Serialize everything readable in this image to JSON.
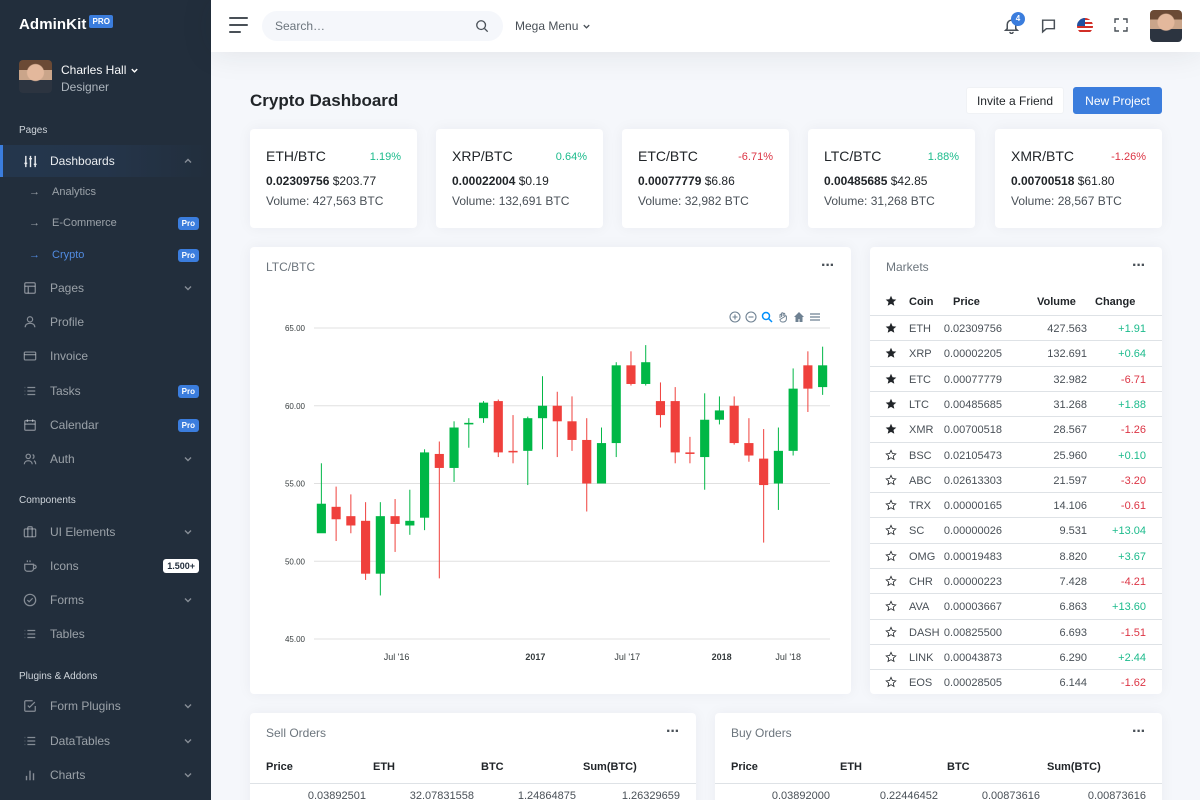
{
  "brand": {
    "name": "AdminKit",
    "badge": "PRO"
  },
  "user": {
    "name": "Charles Hall",
    "role": "Designer"
  },
  "sidebar": {
    "sections": [
      "Pages",
      "Components",
      "Plugins & Addons"
    ],
    "dashboards": "Dashboards",
    "sub": [
      {
        "label": "Analytics",
        "badge": ""
      },
      {
        "label": "E-Commerce",
        "badge": "Pro"
      },
      {
        "label": "Crypto",
        "badge": "Pro"
      }
    ],
    "items": [
      {
        "label": "Pages",
        "icon": "layout-icon"
      },
      {
        "label": "Profile",
        "icon": "user-icon"
      },
      {
        "label": "Invoice",
        "icon": "credit-card-icon"
      },
      {
        "label": "Tasks",
        "icon": "list-icon",
        "badge": "Pro"
      },
      {
        "label": "Calendar",
        "icon": "calendar-icon",
        "badge": "Pro"
      },
      {
        "label": "Auth",
        "icon": "users-icon"
      },
      {
        "label": "UI Elements",
        "icon": "briefcase-icon"
      },
      {
        "label": "Icons",
        "icon": "coffee-icon",
        "badge": "1.500+"
      },
      {
        "label": "Forms",
        "icon": "check-circle-icon"
      },
      {
        "label": "Tables",
        "icon": "list-icon"
      },
      {
        "label": "Form Plugins",
        "icon": "check-square-icon"
      },
      {
        "label": "DataTables",
        "icon": "list-icon"
      },
      {
        "label": "Charts",
        "icon": "bar-chart-icon"
      }
    ]
  },
  "topbar": {
    "search_placeholder": "Search…",
    "mega_menu": "Mega Menu",
    "notifications_count": "4"
  },
  "page": {
    "title_bold": "Crypto",
    "title_rest": " Dashboard",
    "invite_button": "Invite a Friend",
    "new_project_button": "New Project"
  },
  "stats": [
    {
      "pair": "ETH/BTC",
      "change": "1.19%",
      "trend": "pos",
      "btc": "0.02309756",
      "usd": "$203.77",
      "volume": "Volume: 427,563 BTC"
    },
    {
      "pair": "XRP/BTC",
      "change": "0.64%",
      "trend": "pos",
      "btc": "0.00022004",
      "usd": "$0.19",
      "volume": "Volume: 132,691 BTC"
    },
    {
      "pair": "ETC/BTC",
      "change": "-6.71%",
      "trend": "neg",
      "btc": "0.00077779",
      "usd": "$6.86",
      "volume": "Volume: 32,982 BTC"
    },
    {
      "pair": "LTC/BTC",
      "change": "1.88%",
      "trend": "pos",
      "btc": "0.00485685",
      "usd": "$42.85",
      "volume": "Volume: 31,268 BTC"
    },
    {
      "pair": "XMR/BTC",
      "change": "-1.26%",
      "trend": "neg",
      "btc": "0.00700518",
      "usd": "$61.80",
      "volume": "Volume: 28,567 BTC"
    }
  ],
  "chart_card": {
    "title": "LTC/BTC"
  },
  "chart_data": {
    "type": "candlestick",
    "ylim": [
      45,
      65
    ],
    "yticks": [
      "65.00",
      "60.00",
      "55.00",
      "50.00",
      "45.00"
    ],
    "xticks": [
      {
        "label": "Jul '16",
        "bold": false
      },
      {
        "label": "2017",
        "bold": true
      },
      {
        "label": "Jul '17",
        "bold": false
      },
      {
        "label": "2018",
        "bold": true
      },
      {
        "label": "Jul '18",
        "bold": false
      }
    ],
    "up_color": "#00b746",
    "down_color": "#ef403c",
    "candles": [
      [
        53.7,
        56.3,
        52.3,
        51.8,
        1
      ],
      [
        53.5,
        54.8,
        51.3,
        52.7,
        0
      ],
      [
        52.9,
        54.3,
        51.8,
        52.3,
        0
      ],
      [
        52.6,
        53.8,
        48.8,
        49.2,
        0
      ],
      [
        49.2,
        53.8,
        47.8,
        52.9,
        1
      ],
      [
        52.9,
        54.0,
        50.6,
        52.4,
        0
      ],
      [
        52.3,
        54.6,
        51.7,
        52.6,
        1
      ],
      [
        52.8,
        57.2,
        52.0,
        57.0,
        1
      ],
      [
        56.9,
        57.7,
        48.9,
        56.0,
        0
      ],
      [
        56.0,
        59.0,
        55.1,
        58.6,
        1
      ],
      [
        58.8,
        59.2,
        57.3,
        58.9,
        1
      ],
      [
        59.2,
        60.3,
        58.9,
        60.2,
        1
      ],
      [
        60.3,
        60.4,
        56.7,
        57.0,
        0
      ],
      [
        57.0,
        59.4,
        56.3,
        57.1,
        0
      ],
      [
        57.1,
        59.3,
        54.9,
        59.2,
        1
      ],
      [
        59.2,
        61.9,
        57.2,
        60.0,
        1
      ],
      [
        60.0,
        60.9,
        56.7,
        59.0,
        0
      ],
      [
        59.0,
        60.6,
        57.1,
        57.8,
        0
      ],
      [
        57.8,
        59.2,
        53.2,
        55.0,
        0
      ],
      [
        55.0,
        58.6,
        55.0,
        57.6,
        1
      ],
      [
        57.6,
        62.8,
        56.7,
        62.6,
        1
      ],
      [
        62.6,
        63.5,
        61.3,
        61.4,
        0
      ],
      [
        61.4,
        63.9,
        61.3,
        62.8,
        1
      ],
      [
        59.4,
        61.5,
        58.6,
        60.3,
        0
      ],
      [
        60.3,
        61.2,
        56.3,
        57.0,
        0
      ],
      [
        57.0,
        58.0,
        56.3,
        56.9,
        0
      ],
      [
        56.7,
        60.8,
        54.6,
        59.1,
        1
      ],
      [
        59.1,
        60.6,
        58.8,
        59.7,
        1
      ],
      [
        60.0,
        60.6,
        57.5,
        57.6,
        0
      ],
      [
        57.6,
        59.2,
        56.4,
        56.8,
        0
      ],
      [
        56.6,
        58.5,
        51.2,
        54.9,
        0
      ],
      [
        55.0,
        58.6,
        53.3,
        57.1,
        1
      ],
      [
        57.1,
        62.4,
        56.8,
        61.1,
        1
      ],
      [
        62.6,
        63.5,
        59.6,
        61.1,
        0
      ],
      [
        61.2,
        63.8,
        60.7,
        62.6,
        1
      ]
    ]
  },
  "markets": {
    "title": "Markets",
    "columns": [
      "Coin",
      "Price",
      "Volume",
      "Change"
    ],
    "rows": [
      {
        "fav": true,
        "coin": "ETH",
        "price": "0.02309756",
        "volume": "427.563",
        "change": "+1.91",
        "trend": "pos"
      },
      {
        "fav": true,
        "coin": "XRP",
        "price": "0.00002205",
        "volume": "132.691",
        "change": "+0.64",
        "trend": "pos"
      },
      {
        "fav": true,
        "coin": "ETC",
        "price": "0.00077779",
        "volume": "32.982",
        "change": "-6.71",
        "trend": "neg"
      },
      {
        "fav": true,
        "coin": "LTC",
        "price": "0.00485685",
        "volume": "31.268",
        "change": "+1.88",
        "trend": "pos"
      },
      {
        "fav": true,
        "coin": "XMR",
        "price": "0.00700518",
        "volume": "28.567",
        "change": "-1.26",
        "trend": "neg"
      },
      {
        "fav": false,
        "coin": "BSC",
        "price": "0.02105473",
        "volume": "25.960",
        "change": "+0.10",
        "trend": "pos"
      },
      {
        "fav": false,
        "coin": "ABC",
        "price": "0.02613303",
        "volume": "21.597",
        "change": "-3.20",
        "trend": "neg"
      },
      {
        "fav": false,
        "coin": "TRX",
        "price": "0.00000165",
        "volume": "14.106",
        "change": "-0.61",
        "trend": "neg"
      },
      {
        "fav": false,
        "coin": "SC",
        "price": "0.00000026",
        "volume": "9.531",
        "change": "+13.04",
        "trend": "pos"
      },
      {
        "fav": false,
        "coin": "OMG",
        "price": "0.00019483",
        "volume": "8.820",
        "change": "+3.67",
        "trend": "pos"
      },
      {
        "fav": false,
        "coin": "CHR",
        "price": "0.00000223",
        "volume": "7.428",
        "change": "-4.21",
        "trend": "neg"
      },
      {
        "fav": false,
        "coin": "AVA",
        "price": "0.00003667",
        "volume": "6.863",
        "change": "+13.60",
        "trend": "pos"
      },
      {
        "fav": false,
        "coin": "DASH",
        "price": "0.00825500",
        "volume": "6.693",
        "change": "-1.51",
        "trend": "neg"
      },
      {
        "fav": false,
        "coin": "LINK",
        "price": "0.00043873",
        "volume": "6.290",
        "change": "+2.44",
        "trend": "pos"
      },
      {
        "fav": false,
        "coin": "EOS",
        "price": "0.00028505",
        "volume": "6.144",
        "change": "-1.62",
        "trend": "neg"
      }
    ]
  },
  "sell_orders": {
    "title": "Sell Orders",
    "columns": [
      "Price",
      "ETH",
      "BTC",
      "Sum(BTC)"
    ],
    "rows": [
      [
        "0.03892501",
        "32.07831558",
        "1.24864875",
        "1.26329659"
      ]
    ]
  },
  "buy_orders": {
    "title": "Buy Orders",
    "columns": [
      "Price",
      "ETH",
      "BTC",
      "Sum(BTC)"
    ],
    "rows": [
      [
        "0.03892000",
        "0.22446452",
        "0.00873616",
        "0.00873616"
      ]
    ]
  },
  "colors": {
    "primary": "#3b7ddd",
    "sidebar": "#222e3c",
    "success": "#1cbb8c",
    "danger": "#dc3545"
  }
}
